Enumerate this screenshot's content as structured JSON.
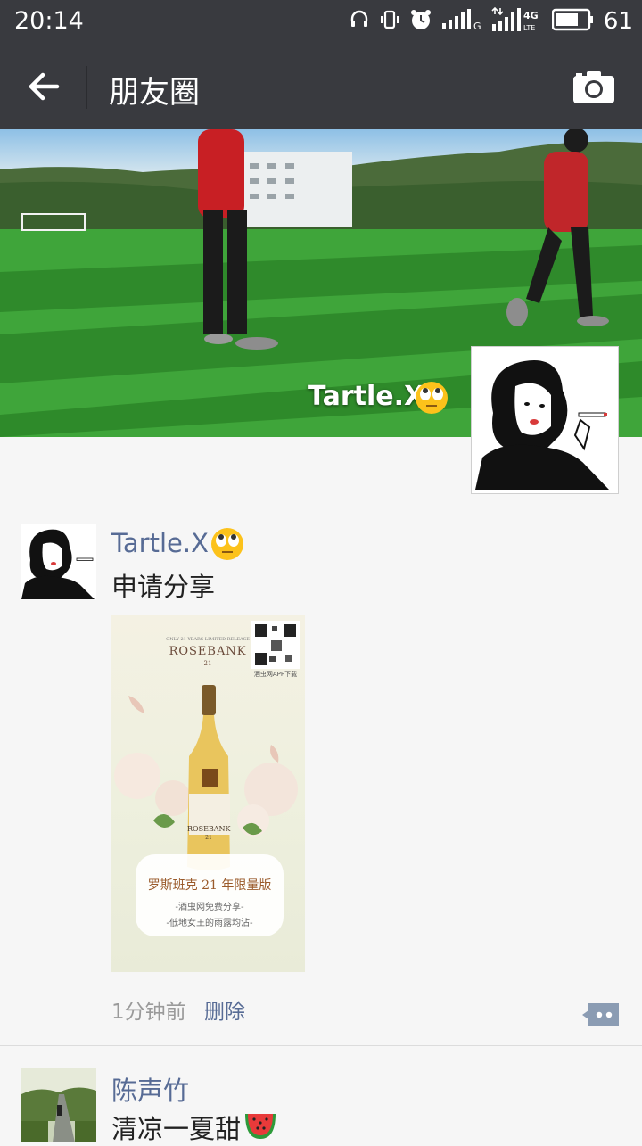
{
  "status_bar": {
    "time": "20:14",
    "battery_percent": "61",
    "icons": [
      "headset-icon",
      "vibrate-icon",
      "alarm-icon",
      "signal-g-icon",
      "signal-4g-icon",
      "battery-icon"
    ]
  },
  "header": {
    "title": "朋友圈",
    "back_icon": "back-arrow-icon",
    "camera_icon": "camera-icon"
  },
  "cover": {
    "user_name": "Tartle.X",
    "emoji": "eye-roll-emoji"
  },
  "posts": [
    {
      "user_name": "Tartle.X",
      "emoji": "eye-roll-emoji",
      "text": "申请分享",
      "image": {
        "brand": "ROSEBANK",
        "top_line": "ONLY 21 YEARS LIMITED RELEASE",
        "year_small": "21",
        "qr_caption": "酒虫网APP下载",
        "bottle_label": "ROSEBANK",
        "bottle_year": "21",
        "promo_title": "罗斯班克 21 年限量版",
        "promo_line1": "-酒虫网免费分享-",
        "promo_line2": "-低地女王的雨露均沾-"
      },
      "time": "1分钟前",
      "delete_label": "删除"
    },
    {
      "user_name": "陈声竹",
      "text": "清凉一夏甜",
      "emoji": "watermelon-emoji"
    }
  ],
  "colors": {
    "header_bg": "#393a3f",
    "name_link": "#576b95",
    "page_bg": "#f6f6f6"
  }
}
